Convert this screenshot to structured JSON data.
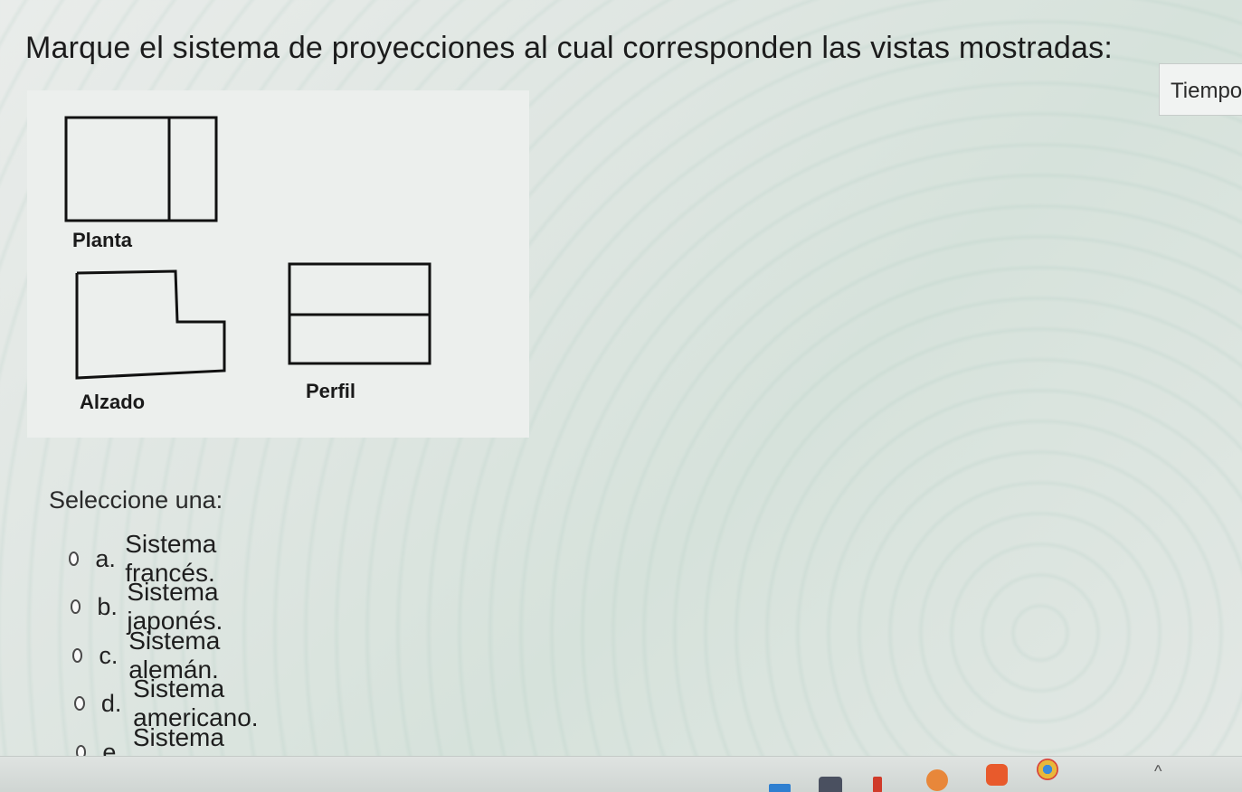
{
  "question": {
    "text": "Marque el sistema de proyecciones al cual corresponden las vistas mostradas:"
  },
  "timer": {
    "label": "Tiempo"
  },
  "figure": {
    "labels": {
      "planta": "Planta",
      "alzado": "Alzado",
      "perfil": "Perfil"
    }
  },
  "answer": {
    "prompt": "Seleccione una:",
    "options": [
      {
        "letter": "a.",
        "text": "Sistema francés."
      },
      {
        "letter": "b.",
        "text": "Sistema japonés."
      },
      {
        "letter": "c.",
        "text": "Sistema alemán."
      },
      {
        "letter": "d.",
        "text": "Sistema americano."
      },
      {
        "letter": "e.",
        "text": "Sistema europeo."
      }
    ]
  },
  "taskbar": {
    "icons": [
      "app-icon",
      "app-icon",
      "app-icon",
      "app-icon",
      "brave-browser-icon",
      "chrome-icon"
    ],
    "colors": {
      "brave": "#e85a2c",
      "chrome": "#3b8ad9",
      "app_orange": "#e8873a"
    }
  }
}
